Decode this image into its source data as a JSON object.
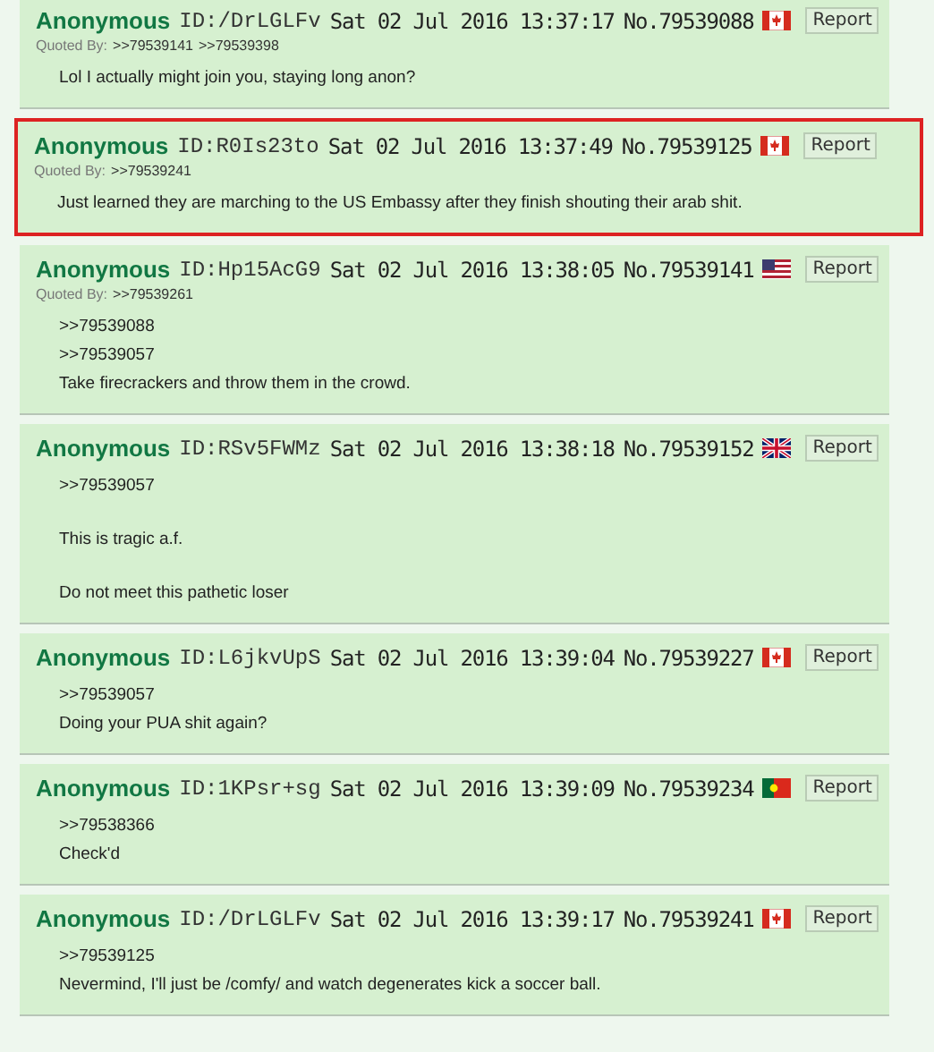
{
  "posts": [
    {
      "name": "Anonymous",
      "id": "ID:/DrLGLFv",
      "date": "Sat 02 Jul 2016 13:37:17",
      "number": "No.79539088",
      "flag": {
        "kind": "ca"
      },
      "report": "Report",
      "highlighted": false,
      "quoted_by_label": "Quoted By:",
      "quoted_by": [
        ">>79539141",
        ">>79539398"
      ],
      "paragraphs": [
        [
          "Lol I actually might join you, staying long anon?"
        ]
      ]
    },
    {
      "name": "Anonymous",
      "id": "ID:R0Is23to",
      "date": "Sat 02 Jul 2016 13:37:49",
      "number": "No.79539125",
      "flag": {
        "kind": "ca"
      },
      "report": "Report",
      "highlighted": true,
      "quoted_by_label": "Quoted By:",
      "quoted_by": [
        ">>79539241"
      ],
      "paragraphs": [
        [
          "Just learned they are marching to the US Embassy after they finish shouting their arab shit."
        ]
      ]
    },
    {
      "name": "Anonymous",
      "id": "ID:Hp15AcG9",
      "date": "Sat 02 Jul 2016 13:38:05",
      "number": "No.79539141",
      "flag": {
        "kind": "us"
      },
      "report": "Report",
      "highlighted": false,
      "quoted_by_label": "Quoted By:",
      "quoted_by": [
        ">>79539261"
      ],
      "paragraphs": [
        [
          ">>79539088",
          ">>79539057",
          "Take firecrackers and throw them in the crowd."
        ]
      ]
    },
    {
      "name": "Anonymous",
      "id": "ID:RSv5FWMz",
      "date": "Sat 02 Jul 2016 13:38:18",
      "number": "No.79539152",
      "flag": {
        "kind": "gb"
      },
      "report": "Report",
      "highlighted": false,
      "paragraphs": [
        [
          ">>79539057"
        ],
        [
          "This is tragic a.f."
        ],
        [
          "Do not meet this pathetic loser"
        ]
      ]
    },
    {
      "name": "Anonymous",
      "id": "ID:L6jkvUpS",
      "date": "Sat 02 Jul 2016 13:39:04",
      "number": "No.79539227",
      "flag": {
        "kind": "ca"
      },
      "report": "Report",
      "highlighted": false,
      "paragraphs": [
        [
          ">>79539057",
          "Doing your PUA shit again?"
        ]
      ]
    },
    {
      "name": "Anonymous",
      "id": "ID:1KPsr+sg",
      "date": "Sat 02 Jul 2016 13:39:09",
      "number": "No.79539234",
      "flag": {
        "kind": "pt"
      },
      "report": "Report",
      "highlighted": false,
      "paragraphs": [
        [
          ">>79538366",
          "Check'd"
        ]
      ]
    },
    {
      "name": "Anonymous",
      "id": "ID:/DrLGLFv",
      "date": "Sat 02 Jul 2016 13:39:17",
      "number": "No.79539241",
      "flag": {
        "kind": "ca"
      },
      "report": "Report",
      "highlighted": false,
      "paragraphs": [
        [
          ">>79539125",
          "Nevermind, I'll just be /comfy/ and watch degenerates kick a soccer ball."
        ]
      ]
    }
  ]
}
